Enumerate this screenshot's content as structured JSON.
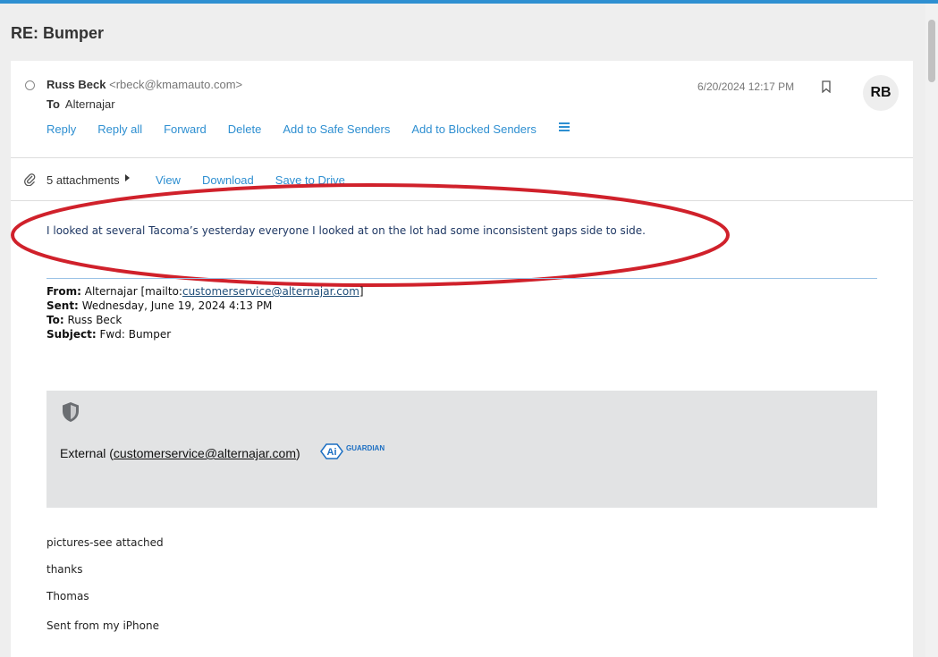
{
  "subject": "RE: Bumper",
  "sender": {
    "name": "Russ Beck",
    "email": "<rbeck@kmamauto.com>"
  },
  "to": {
    "label": "To",
    "value": "Alternajar"
  },
  "date": "6/20/2024 12:17 PM",
  "avatar": "RB",
  "actions": [
    "Reply",
    "Reply all",
    "Forward",
    "Delete",
    "Add to Safe Senders",
    "Add to Blocked Senders"
  ],
  "attachments": {
    "count_label": "5 attachments",
    "actions": [
      "View",
      "Download",
      "Save to Drive"
    ]
  },
  "body": "I looked at several Tacoma’s yesterday everyone I looked at on the lot had some inconsistent gaps side to side.",
  "forwarded": {
    "from_label": "From:",
    "from_value": "Alternajar [mailto:",
    "from_link": "customerservice@alternajar.com",
    "from_end": "]",
    "sent_label": "Sent:",
    "sent_value": "Wednesday, June 19, 2024 4:13 PM",
    "to_label": "To:",
    "to_value": "Russ Beck",
    "subject_label": "Subject:",
    "subject_value": "Fwd: Bumper"
  },
  "guardian": {
    "external_prefix": "External (",
    "external_email": "customerservice@alternajar.com",
    "external_suffix": ")",
    "logo_text": "GUARDIAN",
    "logo_letters": "Ai"
  },
  "message_lines": [
    "pictures-see attached",
    "thanks",
    "Thomas",
    "Sent from my iPhone"
  ],
  "colors": {
    "accent": "#2e8fd1",
    "annotation": "#d0212b",
    "guardian_bg": "#e2e3e4"
  }
}
